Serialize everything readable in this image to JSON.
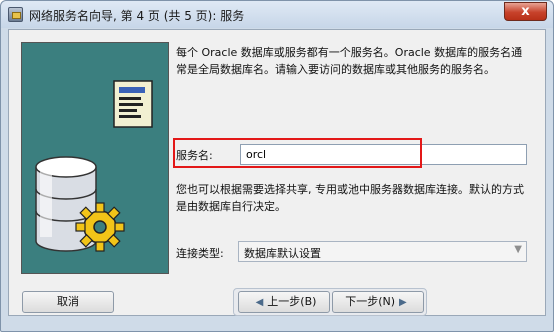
{
  "window": {
    "title": "网络服务名向导, 第 4 页 (共 5 页): 服务",
    "close_glyph": "x"
  },
  "main": {
    "description": "每个 Oracle 数据库或服务都有一个服务名。Oracle 数据库的服务名通常是全局数据库名。请输入要访问的数据库或其他服务的服务名。",
    "service_name_label": "服务名:",
    "service_name_value": "orcl",
    "note": "您也可以根据需要选择共享, 专用或池中服务器数据库连接。默认的方式是由数据库自行决定。",
    "connection_type_label": "连接类型:",
    "connection_type_value": "数据库默认设置"
  },
  "footer": {
    "cancel_label": "取消",
    "prev_label": "上一步(B)",
    "next_label": "下一步(N)"
  },
  "colors": {
    "side_panel": "#3b7f7f",
    "highlight": "#e31818",
    "close_button": "#c7422b"
  }
}
